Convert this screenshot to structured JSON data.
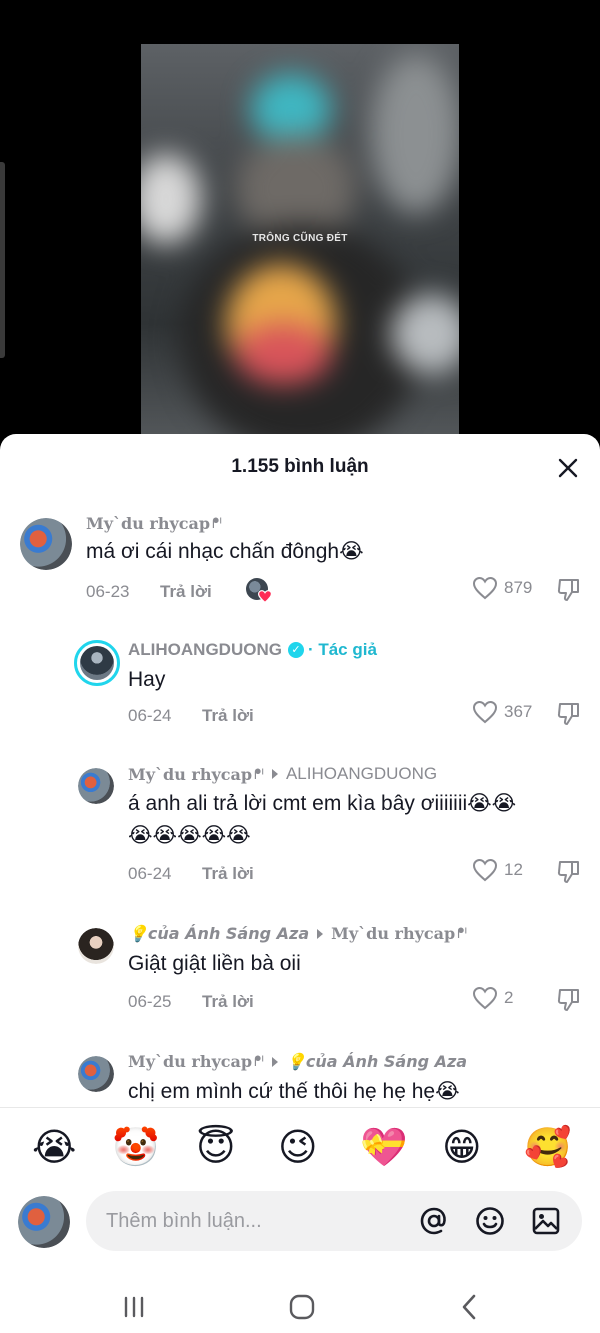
{
  "video": {
    "caption": "TRÔNG CŨNG ĐÉT"
  },
  "sheet": {
    "title": "1.155 bình luận",
    "close_icon": "close-icon"
  },
  "comments": [
    {
      "username": "My`du rhycap",
      "username_deco": "ᖰᑊ",
      "text": "má ơi cái nhạc chấn đôngh😭",
      "date": "06-23",
      "reply_label": "Trả lời",
      "likes": "879",
      "liked_by_creator": true
    },
    {
      "username": "ALIHOANGDUONG",
      "verified": true,
      "author_tag": "· Tác giả",
      "text": "Hay",
      "date": "06-24",
      "reply_label": "Trả lời",
      "likes": "367"
    },
    {
      "username": "My`du rhycap",
      "username_deco": "ᖰᑊ",
      "reply_to": "ALIHOANGDUONG",
      "text_line1": "á anh ali trả lời cmt em kìa bây ơiiiiiii😭😭",
      "text_line2": "😭😭😭😭😭",
      "date": "06-24",
      "reply_label": "Trả lời",
      "likes": "12"
    },
    {
      "username": "💡của Ánh Sáng Aza",
      "reply_to": "My`du rhycap",
      "reply_to_deco": "ᖰᑊ",
      "text": "Giật giật liền bà oii",
      "date": "06-25",
      "reply_label": "Trả lời",
      "likes": "2"
    },
    {
      "username": "My`du rhycap",
      "username_deco": "ᖰᑊ",
      "reply_to": "💡của Ánh Sáng Aza",
      "text": "chị em mình cứ thế thôi hẹ hẹ hẹ😭"
    }
  ],
  "emoji_bar": [
    "😭",
    "🤡",
    "😇",
    "😉",
    "💝",
    "😁",
    "🥰"
  ],
  "composer": {
    "placeholder": "Thêm bình luận...",
    "icons": [
      "mention-icon",
      "emoji-icon",
      "image-icon"
    ]
  },
  "nav": {
    "icons": [
      "recent-apps-icon",
      "home-icon",
      "back-icon"
    ]
  },
  "colors": {
    "accent": "#20d5ec",
    "text_primary": "#161823",
    "text_secondary": "#8a8b91",
    "input_bg": "#f1f1f2",
    "like_badge": "#fe2c55"
  }
}
